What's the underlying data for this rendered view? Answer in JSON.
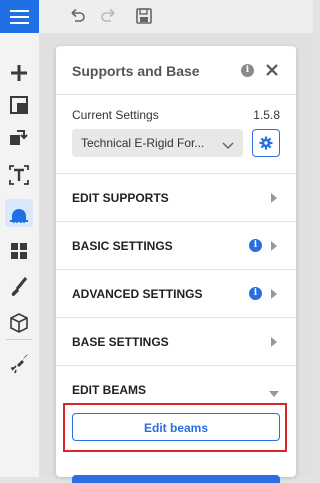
{
  "panel": {
    "title": "Supports and Base",
    "current_settings_label": "Current Settings",
    "version": "1.5.8",
    "profile_value": "Technical E-Rigid For...",
    "sections": [
      {
        "label": "EDIT SUPPORTS",
        "info": false,
        "expanded": false
      },
      {
        "label": "BASIC SETTINGS",
        "info": true,
        "expanded": false
      },
      {
        "label": "ADVANCED SETTINGS",
        "info": true,
        "expanded": false
      },
      {
        "label": "BASE SETTINGS",
        "info": false,
        "expanded": false
      },
      {
        "label": "EDIT BEAMS",
        "info": false,
        "expanded": true
      }
    ],
    "edit_beams_button": "Edit beams"
  },
  "icons": {
    "menu": "hamburger-icon",
    "undo": "undo-icon",
    "redo": "redo-icon",
    "save": "save-icon",
    "tools": [
      "add-icon",
      "layout-icon",
      "orient-icon",
      "text-icon",
      "supports-icon",
      "arrange-icon",
      "paint-icon",
      "hollow-icon",
      "print-icon"
    ]
  },
  "colors": {
    "accent": "#1f6fe5",
    "highlight": "#d9262b"
  }
}
